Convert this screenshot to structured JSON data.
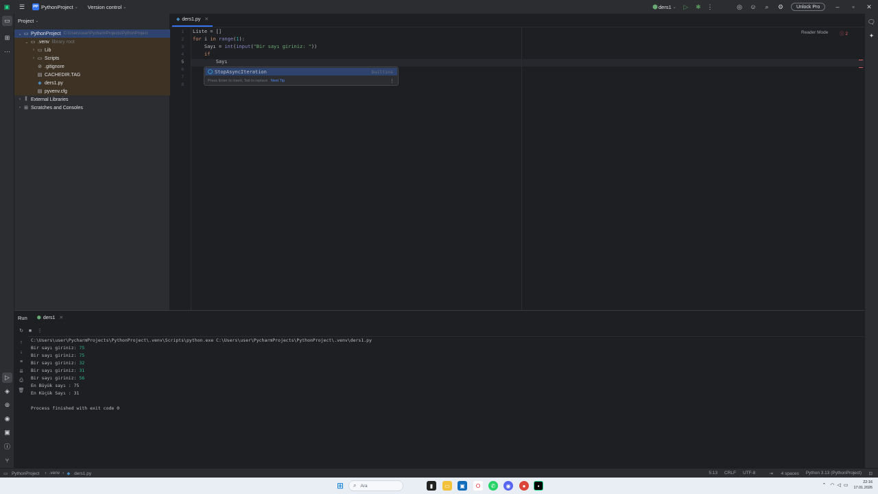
{
  "titlebar": {
    "project_name": "PythonProject",
    "project_badge": "PP",
    "vcs": "Version control",
    "run_config": "ders1",
    "unlock": "Unlock Pro"
  },
  "project_panel": {
    "title": "Project",
    "root": "PythonProject",
    "root_path": "C:\\Users\\user\\PycharmProjects\\PythonProject",
    "venv": ".venv",
    "venv_hint": "library root",
    "items": [
      ".venv",
      "Lib",
      "Scripts",
      ".gitignore",
      "CACHEDIR.TAG",
      "ders1.py",
      "pyvenv.cfg"
    ],
    "external_libraries": "External Libraries",
    "scratches": "Scratches and Consoles"
  },
  "editor": {
    "tab": "ders1.py",
    "reader_mode": "Reader Mode",
    "error_count": "2",
    "line_numbers": [
      "1",
      "2",
      "3",
      "4",
      "5",
      "6",
      "7",
      "8"
    ],
    "code": {
      "l1": "Liste = []",
      "l2_kw": "for",
      "l2_a": " i ",
      "l2_kw2": "in",
      "l2_fn": " range",
      "l2_num": "1",
      "l3_a": "Sayı = ",
      "l3_fn": "int",
      "l3_fn2": "input",
      "l3_str": "\"Bir sayı giriniz: \"",
      "l4_kw": "if",
      "l5": "Sayı"
    }
  },
  "completion": {
    "item": "StopAsyncIteration",
    "type": "builtins",
    "hint": "Press Enter to insert, Tab to replace",
    "next_tip": "Next Tip"
  },
  "run_panel": {
    "title": "Run",
    "tab": "ders1",
    "command": "C:\\Users\\user\\PycharmProjects\\PythonProject\\.venv\\Scripts\\python.exe C:\\Users\\user\\PycharmProjects\\PythonProject\\.venv\\ders1.py",
    "prompt": "Bir sayı giriniz: ",
    "inputs": [
      "75",
      "75",
      "32",
      "31",
      "56"
    ],
    "max_line": "En Büyük sayı : 75",
    "min_line": "En Küçük Sayı : 31",
    "finished": "Process finished with exit code 0"
  },
  "status_bar": {
    "breadcrumb": [
      "PythonProject",
      ".venv",
      "ders1.py"
    ],
    "position": "5:13",
    "line_sep": "CRLF",
    "encoding": "UTF-8",
    "indent": "4 spaces",
    "interpreter": "Python 3.13 (PythonProject)"
  },
  "taskbar": {
    "search_placeholder": "Ara",
    "time": "22:16",
    "date": "17.01.2026"
  }
}
